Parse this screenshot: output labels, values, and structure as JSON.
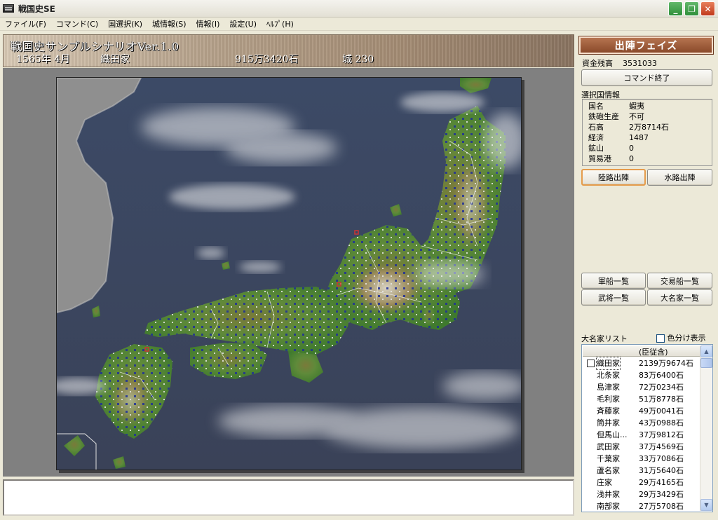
{
  "window": {
    "title": "戦国史SE"
  },
  "menu": [
    "ファイル(F)",
    "コマンド(C)",
    "国選択(K)",
    "城情報(S)",
    "情報(I)",
    "設定(U)",
    "ﾍﾙﾌﾟ(H)"
  ],
  "header": {
    "scenario": "戦国史サンプルシナリオVer.1.0",
    "date": "1565年 4月",
    "clan": "織田家",
    "koku": "915万3420石",
    "castles": "城 230"
  },
  "panel": {
    "phase": "出陣フェイズ",
    "funds_label": "資金残高",
    "funds_value": "3531033",
    "end_command": "コマンド終了",
    "province_info_label": "選択国情報",
    "province_info": [
      {
        "k": "国名",
        "v": "蝦夷"
      },
      {
        "k": "鉄砲生産",
        "v": "不可"
      },
      {
        "k": "石高",
        "v": "2万8714石"
      },
      {
        "k": "経済",
        "v": "1487"
      },
      {
        "k": "鉱山",
        "v": "0"
      },
      {
        "k": "貿易港",
        "v": "0"
      }
    ],
    "land_deploy": "陸路出陣",
    "sea_deploy": "水路出陣",
    "warships": "軍船一覧",
    "trade_ships": "交易船一覧",
    "generals": "武将一覧",
    "daimyo_list_btn": "大名家一覧",
    "daimyo_list_label": "大名家リスト",
    "color_toggle_label": "色分け表示",
    "list_column": "(臣従含)",
    "daimyo": [
      {
        "name": "織田家",
        "koku": "2139万9674石"
      },
      {
        "name": "北条家",
        "koku": "83万6400石"
      },
      {
        "name": "島津家",
        "koku": "72万0234石"
      },
      {
        "name": "毛利家",
        "koku": "51万8778石"
      },
      {
        "name": "斉藤家",
        "koku": "49万0041石"
      },
      {
        "name": "筒井家",
        "koku": "43万0988石"
      },
      {
        "name": "但馬山...",
        "koku": "37万9812石"
      },
      {
        "name": "武田家",
        "koku": "37万4569石"
      },
      {
        "name": "千葉家",
        "koku": "33万7086石"
      },
      {
        "name": "蘆名家",
        "koku": "31万5640石"
      },
      {
        "name": "庄家",
        "koku": "29万4165石"
      },
      {
        "name": "浅井家",
        "koku": "29万3429石"
      },
      {
        "name": "南部家",
        "koku": "27万5708石"
      }
    ]
  }
}
